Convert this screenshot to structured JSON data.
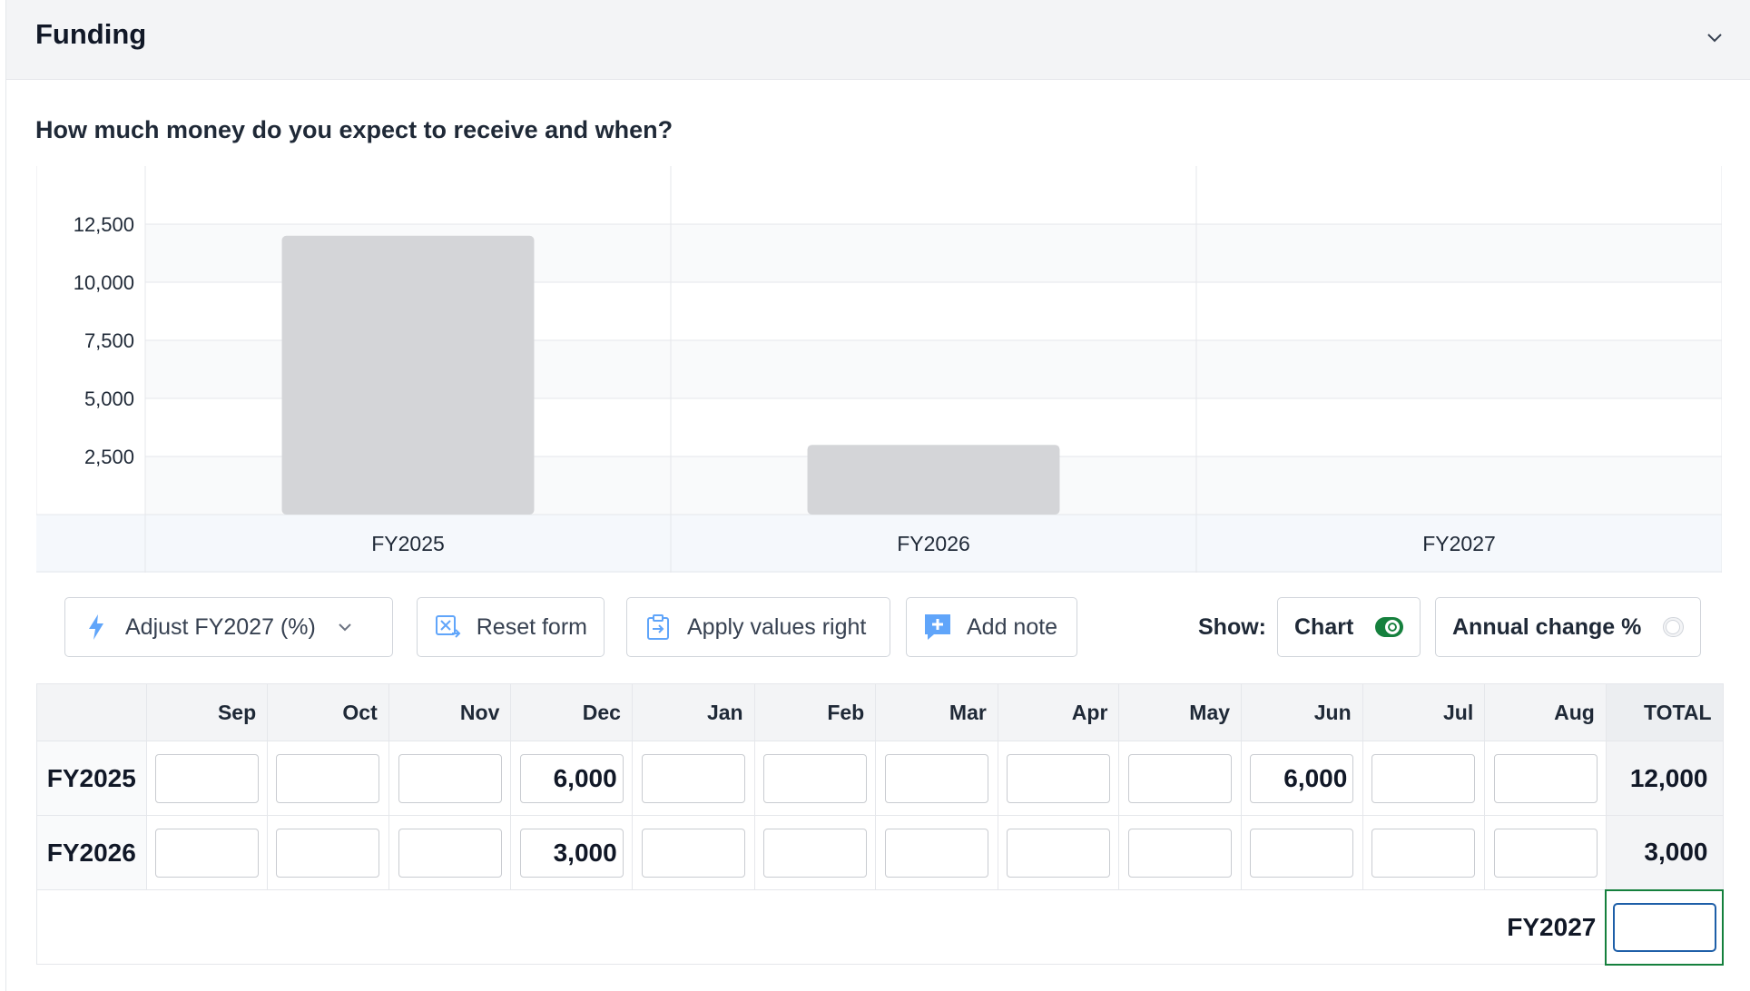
{
  "panel": {
    "title": "Funding",
    "question": "How much money do you expect to receive and when?"
  },
  "chart_data": {
    "type": "bar",
    "categories": [
      "FY2025",
      "FY2026",
      "FY2027"
    ],
    "values": [
      12000,
      3000,
      0
    ],
    "yticks": [
      "2,500",
      "5,000",
      "7,500",
      "10,000",
      "12,500"
    ],
    "ytick_values": [
      2500,
      5000,
      7500,
      10000,
      12500
    ],
    "ylim": [
      0,
      15000
    ],
    "grid": true,
    "bar_color": "#d4d5d8"
  },
  "toolbar": {
    "adjust_label": "Adjust FY2027 (%)",
    "reset_label": "Reset form",
    "apply_label": "Apply values right",
    "note_label": "Add note",
    "show_label": "Show:",
    "chart_label": "Chart",
    "chart_on": true,
    "annual_label": "Annual change %",
    "annual_on": false
  },
  "table": {
    "months": [
      "Sep",
      "Oct",
      "Nov",
      "Dec",
      "Jan",
      "Feb",
      "Mar",
      "Apr",
      "May",
      "Jun",
      "Jul",
      "Aug"
    ],
    "total_header": "TOTAL",
    "rows": [
      {
        "label": "FY2025",
        "values": [
          "",
          "",
          "",
          "6,000",
          "",
          "",
          "",
          "",
          "",
          "6,000",
          "",
          ""
        ],
        "total": "12,000"
      },
      {
        "label": "FY2026",
        "values": [
          "",
          "",
          "",
          "3,000",
          "",
          "",
          "",
          "",
          "",
          "",
          "",
          ""
        ],
        "total": "3,000"
      }
    ],
    "fy2027_label": "FY2027",
    "fy2027_value": ""
  },
  "colors": {
    "accent": "#15803d",
    "focus": "#1e5fa8",
    "icon": "#3b82f6"
  }
}
